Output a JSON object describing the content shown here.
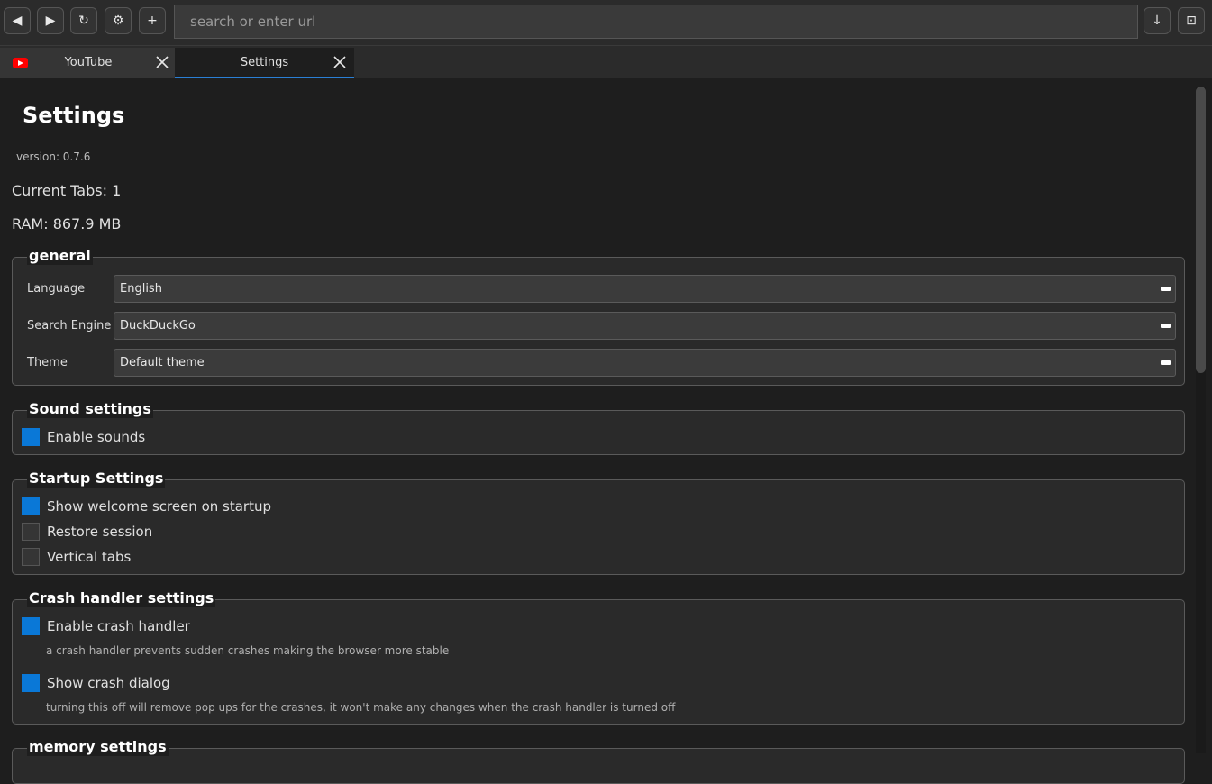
{
  "toolbar": {
    "back": "◀",
    "forward": "▶",
    "reload": "↻",
    "settings": "⚙",
    "new_tab": "+",
    "url_placeholder": "search or enter url",
    "download": "↓",
    "window": "⊡"
  },
  "tabs": [
    {
      "label": "YouTube",
      "icon": "youtube-icon",
      "active": false
    },
    {
      "label": "Settings",
      "active": true
    }
  ],
  "settings": {
    "title": "Settings",
    "version": "version: 0.7.6",
    "current_tabs": "Current Tabs: 1",
    "ram": "RAM: 867.9 MB",
    "general": {
      "title": "general",
      "language_label": "Language",
      "language_value": "English",
      "search_label": "Search Engine",
      "search_value": "DuckDuckGo",
      "theme_label": "Theme",
      "theme_value": "Default theme"
    },
    "sound": {
      "title": "Sound settings",
      "enable_sounds": "Enable sounds",
      "enable_sounds_checked": true
    },
    "startup": {
      "title": "Startup Settings",
      "welcome": "Show welcome screen on startup",
      "welcome_checked": true,
      "restore": "Restore session",
      "restore_checked": false,
      "vertical": "Vertical tabs",
      "vertical_checked": false
    },
    "crash": {
      "title": "Crash handler settings",
      "enable": "Enable crash handler",
      "enable_checked": true,
      "enable_hint": "a crash handler prevents sudden crashes making the browser more stable",
      "dialog": "Show crash dialog",
      "dialog_checked": true,
      "dialog_hint": "turning this off will remove pop ups for the crashes, it won't make any changes when the crash handler is turned off"
    },
    "memory": {
      "title": "memory settings"
    }
  },
  "colors": {
    "accent": "#0a78d7",
    "background": "#1e1e1e",
    "group_background": "#2a2a2a"
  }
}
